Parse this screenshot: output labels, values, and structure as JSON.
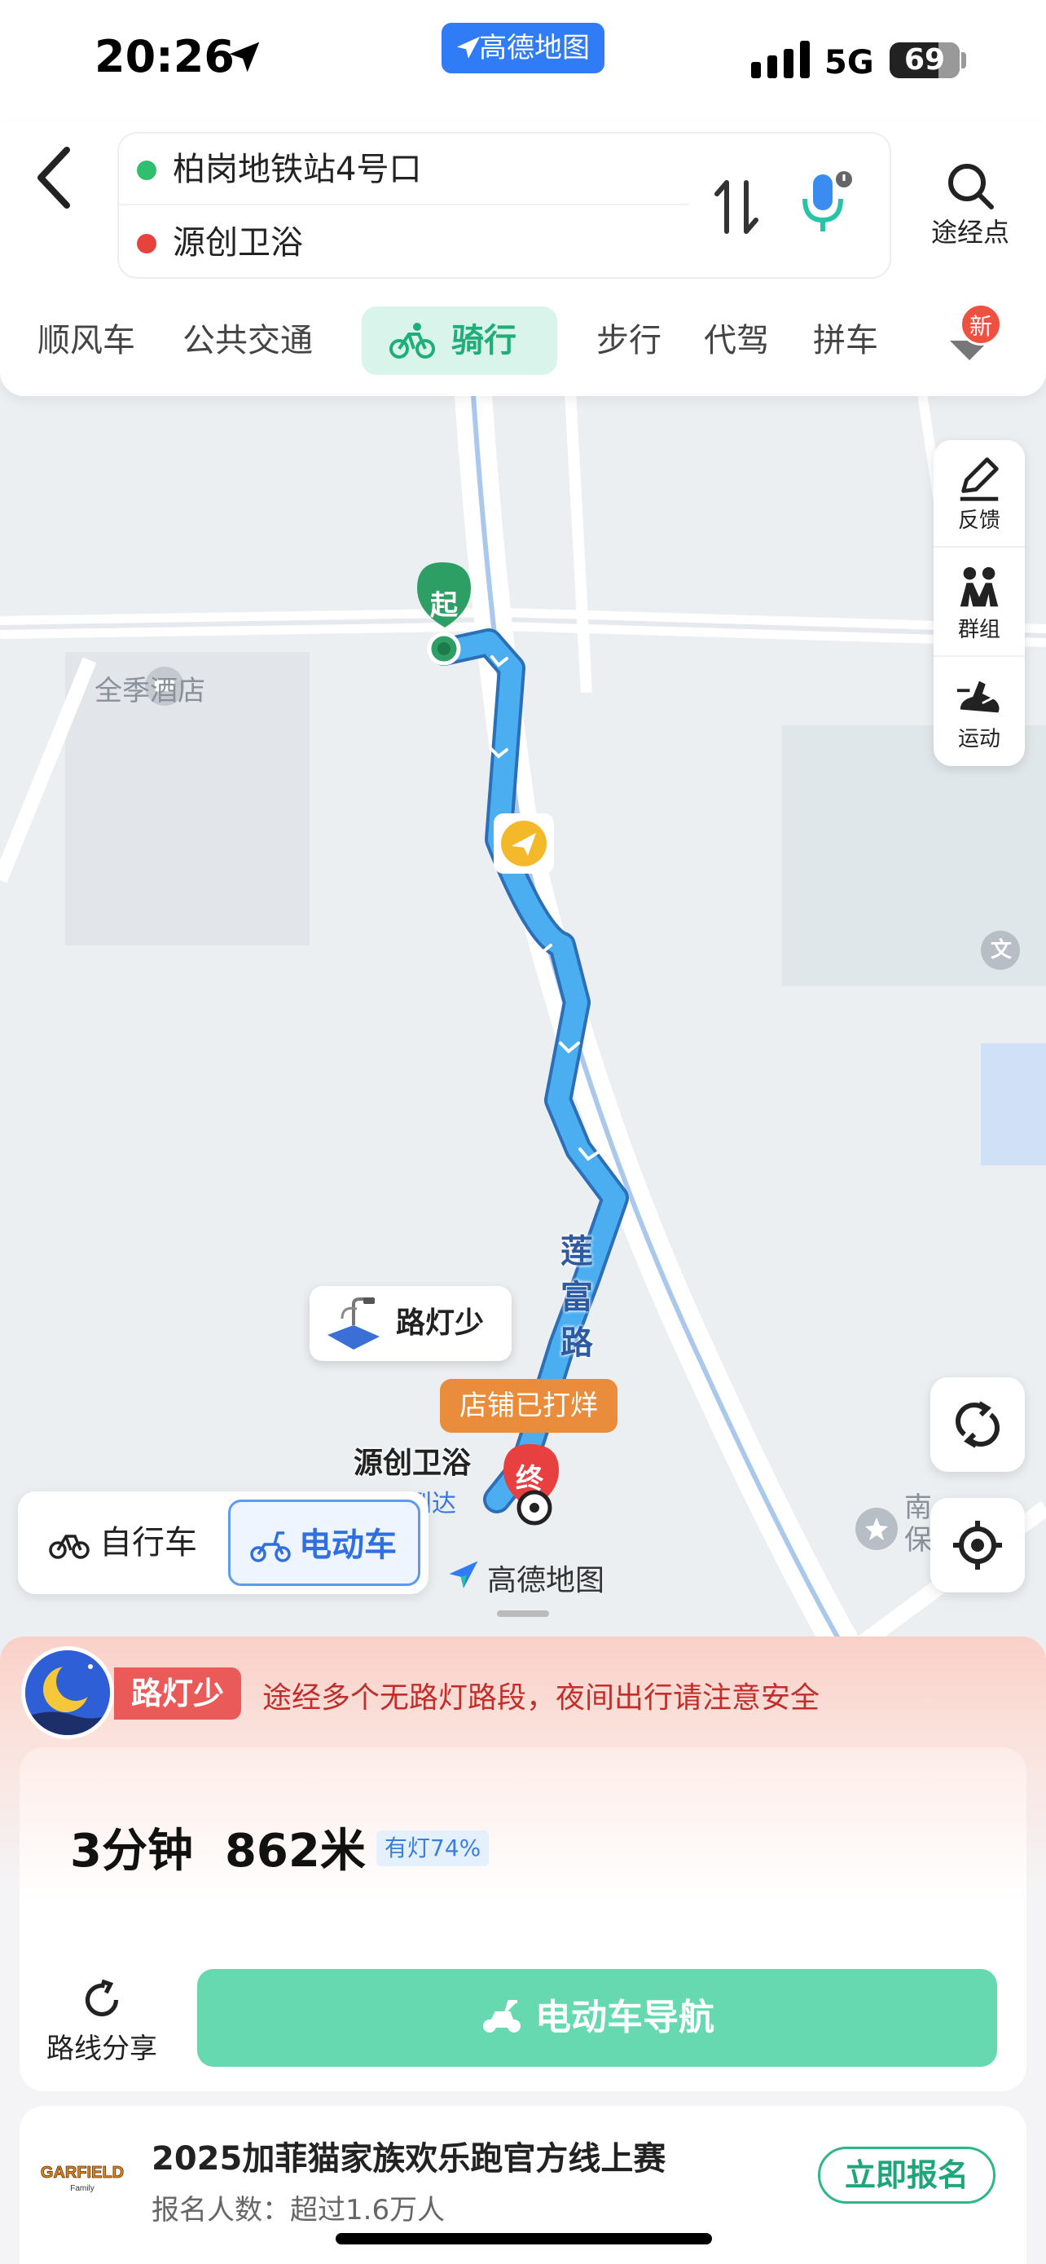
{
  "status_bar": {
    "time": "20:26",
    "app_label": "高德地图",
    "network": "5G",
    "battery": "69"
  },
  "header": {
    "start": "柏岗地铁站4号口",
    "end": "源创卫浴",
    "waypoint_label": "途经点"
  },
  "tabs": [
    {
      "label": "顺风车"
    },
    {
      "label": "公共交通"
    },
    {
      "label": "骑行",
      "active": true
    },
    {
      "label": "步行"
    },
    {
      "label": "代驾"
    },
    {
      "label": "拼车"
    }
  ],
  "new_badge": "新",
  "map": {
    "start_marker": "起",
    "end_marker": "终",
    "hotel_label": "全季酒店",
    "road_label": "莲富路",
    "culture_icon_label": "文",
    "south_label_line1": "南",
    "south_label_line2": "保",
    "streetlight_callout": "路灯少",
    "shop_tag": "店铺已打烊",
    "destination_label": "源创卫浴",
    "arrive_label": "到达",
    "logo_label": "高德地图",
    "side_tools": [
      {
        "label": "反馈",
        "icon": "feedback-icon"
      },
      {
        "label": "群组",
        "icon": "group-icon"
      },
      {
        "label": "运动",
        "icon": "sport-icon"
      }
    ]
  },
  "mode_switch": {
    "bike": "自行车",
    "ebike": "电动车"
  },
  "route_panel": {
    "warning_tag": "路灯少",
    "warning_text": "途经多个无路灯路段，夜间出行请注意安全",
    "duration": "3分钟",
    "distance": "862米",
    "light_ratio": "有灯74%",
    "share_label": "路线分享",
    "nav_button": "电动车导航"
  },
  "promo": {
    "title": "2025加菲猫家族欢乐跑官方线上赛",
    "subtitle": "报名人数：超过1.6万人",
    "button": "立即报名",
    "logo_text": "GARFIELD"
  },
  "colors": {
    "route": "#4aaef0",
    "accent_green": "#1fae7a",
    "warning_red": "#ea5a58",
    "ebike_blue": "#2f6fe0"
  }
}
